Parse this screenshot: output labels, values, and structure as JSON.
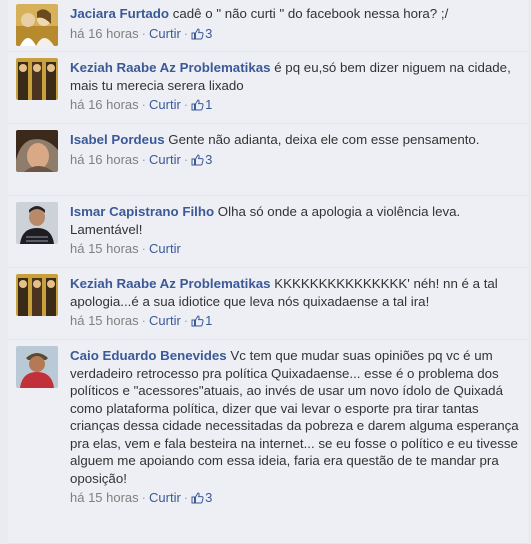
{
  "comments": [
    {
      "author": "Jaciara Furtado",
      "text": "cadê o \" não curti \" do facebook nessa hora? ;/",
      "time": "há 16 horas",
      "like_label": "Curtir",
      "likes": "3",
      "avatar_icon": "user-photo-icon"
    },
    {
      "author": "Keziah Raabe Az Problematikas",
      "text": "é pq eu,só bem dizer niguem na cidade, mais tu merecia serera lixado",
      "time": "há 16 horas",
      "like_label": "Curtir",
      "likes": "1",
      "avatar_icon": "user-photo-icon"
    },
    {
      "author": "Isabel Pordeus",
      "text": "Gente não adianta, deixa ele com esse pensamento.",
      "time": "há 16 horas",
      "like_label": "Curtir",
      "likes": "3",
      "avatar_icon": "user-photo-icon"
    },
    {
      "author": "Ismar Capistrano Filho",
      "text": "Olha só onde a apologia a violência leva. Lamentável!",
      "time": "há 15 horas",
      "like_label": "Curtir",
      "likes": "",
      "avatar_icon": "user-photo-icon"
    },
    {
      "author": "Keziah Raabe Az Problematikas",
      "text": "KKKKKKKKKKKKKKK' néh! nn é a tal apologia...é a sua idiotice que leva nós quixadaense a tal ira!",
      "time": "há 15 horas",
      "like_label": "Curtir",
      "likes": "1",
      "avatar_icon": "user-photo-icon"
    },
    {
      "author": "Caio Eduardo Benevides",
      "text": "Vc tem que mudar suas opiniões pq vc é um verdadeiro retrocesso pra política Quixadaense... esse é o problema dos políticos e \"acessores\"atuais, ao invés de usar um novo ídolo de Quixadá como plataforma política, dizer que vai levar o esporte pra tirar tantas crianças dessa cidade necessitadas da pobreza e darem alguma esperança pra elas, vem e fala besteira na internet... se eu fosse o político e eu tivesse alguem me apoiando com essa ideia, faria era questão de te mandar pra oposição!",
      "time": "há 15 horas",
      "like_label": "Curtir",
      "likes": "3",
      "avatar_icon": "user-photo-icon"
    }
  ],
  "colors": {
    "author": "#3b5998",
    "text": "#333333",
    "meta": "#7f7f7f",
    "background": "#edeff4"
  }
}
